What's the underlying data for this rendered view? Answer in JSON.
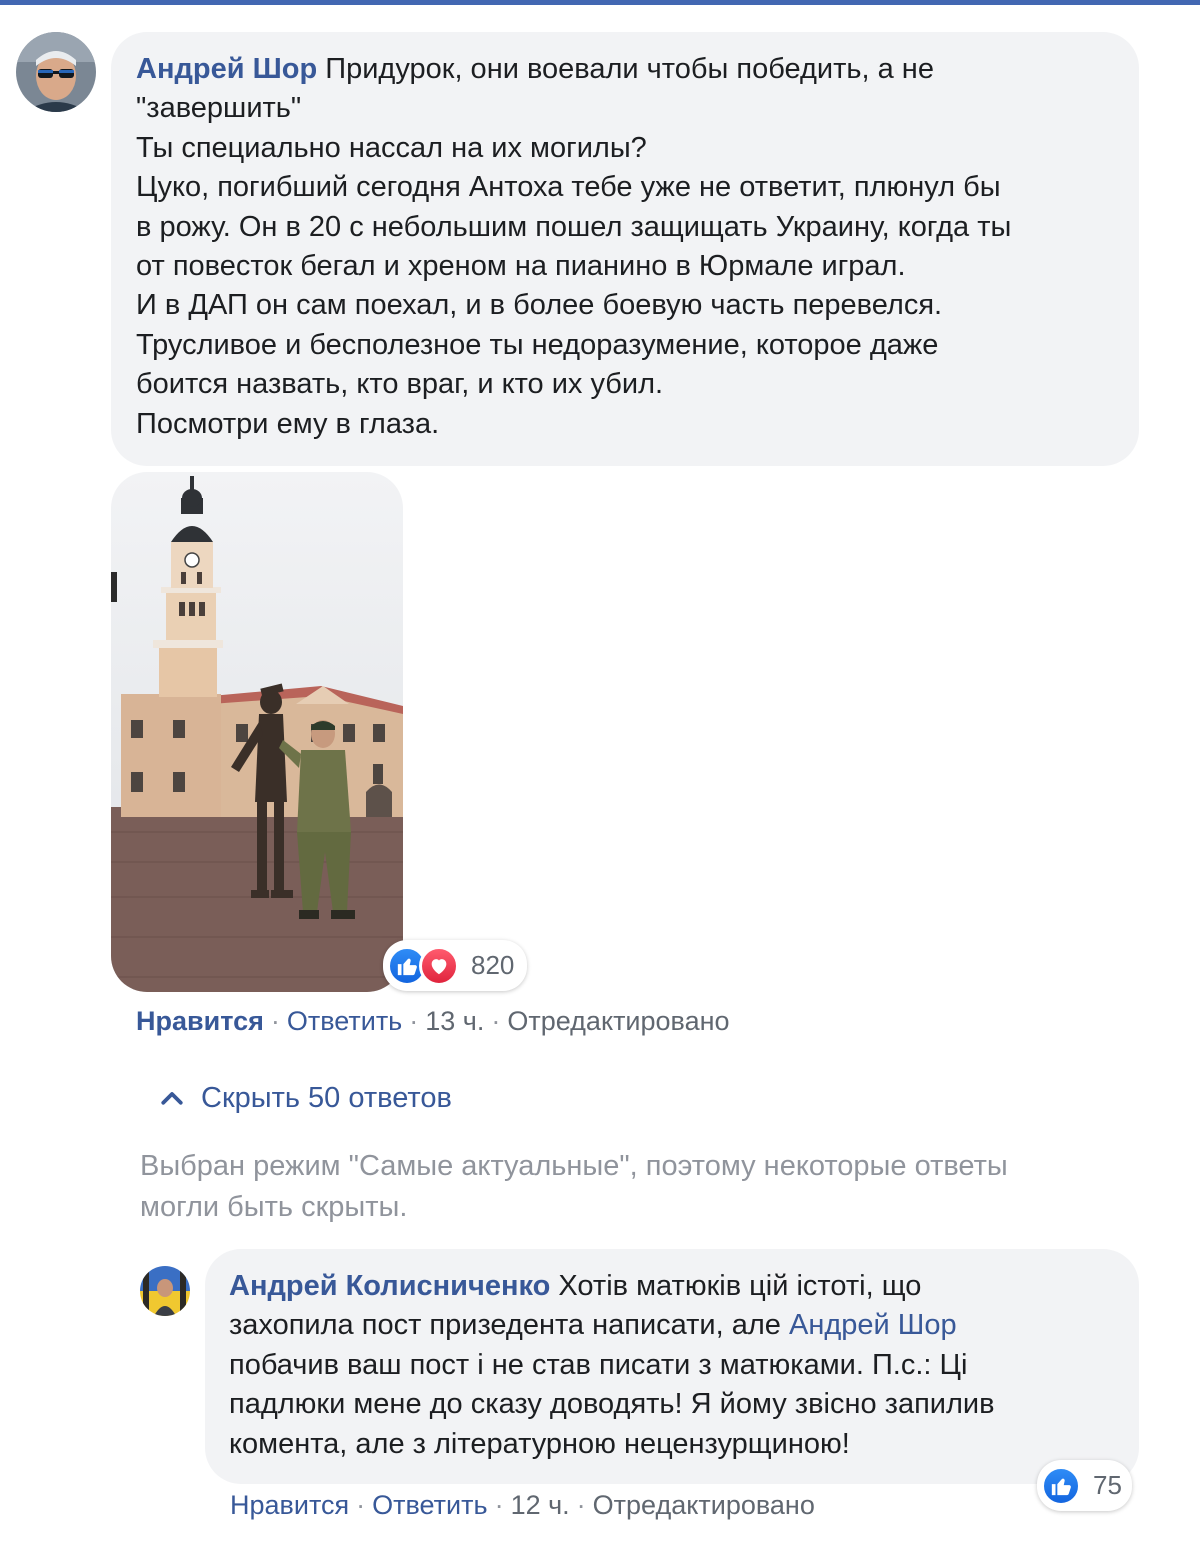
{
  "comment1": {
    "author": "Андрей Шор",
    "lines": [
      "Придурок, они воевали чтобы победить, а не",
      "\"завершить\"",
      "Ты специально нассал на их могилы?",
      "Цуко, погибший сегодня Антоха тебе уже не ответит, плюнул бы",
      "в рожу. Он в 20 с небольшим пошел защищать Украину, когда ты",
      "от повесток бегал и хреном на пианино в Юрмале играл.",
      "И в ДАП он сам поехал, и в более боевую часть перевелся.",
      "Трусливое и бесполезное ты недоразумение, которое даже",
      "боится назвать, кто враг, и кто их убил.",
      "Посмотри ему в глаза."
    ],
    "reactions": {
      "icons": [
        "like-icon",
        "love-icon"
      ],
      "count": "820"
    },
    "actions": {
      "like": "Нравится",
      "reply": "Ответить",
      "time": "13 ч.",
      "edited": "Отредактировано"
    }
  },
  "replies_toggle": {
    "icon": "chevron-up-icon",
    "label": "Скрыть 50 ответов"
  },
  "notice": {
    "lines": [
      "Выбран режим \"Самые актуальные\", поэтому некоторые ответы",
      "могли быть скрыты."
    ]
  },
  "comment2": {
    "author": "Андрей Колисниченко",
    "line1": "Хотів матюків цій істоті, що",
    "line2_text": "захопила пост призедента написати, але ",
    "line2_mention": "Андрей Шор",
    "lines_rest": [
      "побачив ваш пост і не став писати з матюками. П.с.: Ці",
      "падлюки мене до сказу доводять! Я йому звісно запилив",
      "комента, але з літературною нецензурщиною!"
    ],
    "reactions": {
      "icons": [
        "like-icon"
      ],
      "count": "75"
    },
    "actions": {
      "like": "Нравится",
      "reply": "Ответить",
      "time": "12 ч.",
      "edited": "Отредактировано"
    }
  },
  "colors": {
    "link": "#385898",
    "bubble": "#f2f3f5",
    "meta": "#606770",
    "muted": "#90949c",
    "like": "#1877f2",
    "love": "#f33e58"
  }
}
